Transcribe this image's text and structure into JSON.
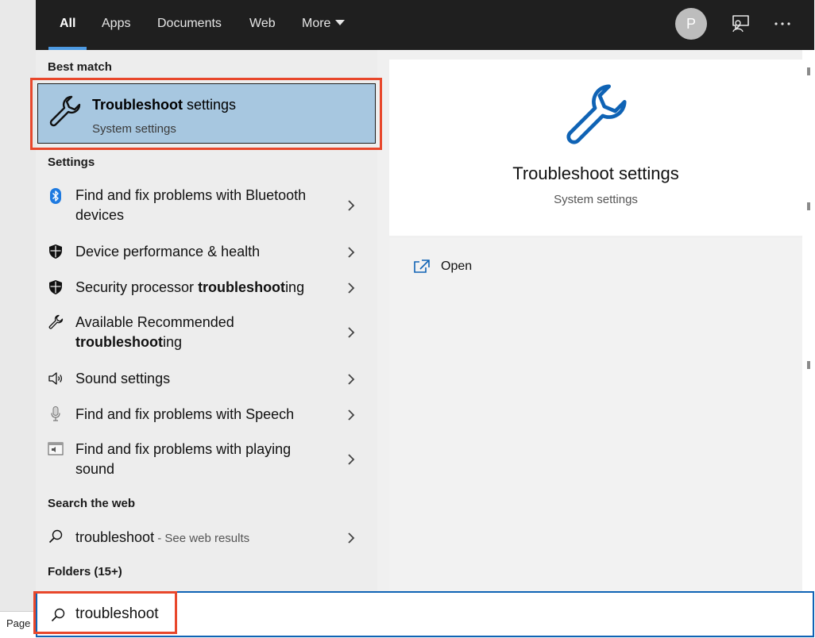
{
  "background": {
    "page_label": "Page"
  },
  "tabs": [
    {
      "label": "All"
    },
    {
      "label": "Apps"
    },
    {
      "label": "Documents"
    },
    {
      "label": "Web"
    }
  ],
  "more_label": "More",
  "avatar_initial": "P",
  "sections": {
    "best_match": "Best match",
    "settings": "Settings",
    "search_web": "Search the web",
    "folders": "Folders (15+)"
  },
  "best_match": {
    "title_bold": "Troubleshoot",
    "title_rest": " settings",
    "subtitle": "System settings"
  },
  "settings_items": [
    {
      "icon": "bluetooth-icon",
      "l1": "Find and fix problems with Bluetooth",
      "l2": "devices"
    },
    {
      "icon": "shield-icon",
      "text": "Device performance & health"
    },
    {
      "icon": "shield-icon",
      "pre": "Security processor ",
      "bold": "troubleshoot",
      "post": "ing"
    },
    {
      "icon": "wrench-icon",
      "l1": "Available Recommended",
      "bold2": "troubleshoot",
      "post2": "ing"
    },
    {
      "icon": "speaker-icon",
      "text": "Sound settings"
    },
    {
      "icon": "microphone-icon",
      "text": "Find and fix problems with Speech"
    },
    {
      "icon": "sound-window-icon",
      "l1": "Find and fix problems with playing",
      "l2": "sound"
    }
  ],
  "web_result": {
    "query": "troubleshoot",
    "suffix": " - See web results"
  },
  "preview": {
    "title": "Troubleshoot settings",
    "subtitle": "System settings",
    "open_label": "Open"
  },
  "search": {
    "value": "troubleshoot"
  },
  "colors": {
    "accent": "#0f63b5",
    "highlight": "#a7c7e0",
    "callout": "#e8472b",
    "topbar": "#1f1f1f"
  }
}
